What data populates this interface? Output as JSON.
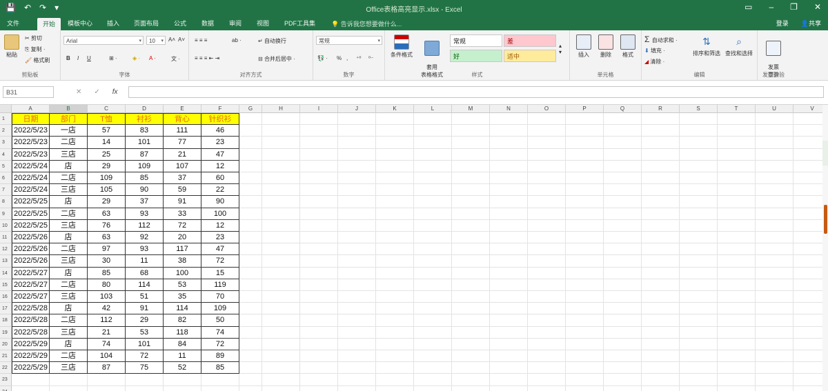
{
  "window": {
    "title": "Office表格高亮显示.xlsx - Excel",
    "user": "共享",
    "login": "登录",
    "qat": {
      "save": "💾",
      "undo": "↶",
      "redo": "↷",
      "more": "▾"
    },
    "controls": {
      "ribbon_opts": "▭",
      "minimize": "–",
      "restore": "❐",
      "close": "✕"
    }
  },
  "tabs": [
    "文件",
    "开始",
    "模板中心",
    "插入",
    "页面布局",
    "公式",
    "数据",
    "审阅",
    "视图",
    "PDF工具集"
  ],
  "active_tab": "开始",
  "tell_me": "告诉我您想要做什么...",
  "ribbon": {
    "clipboard": {
      "label": "剪贴板",
      "paste": "粘贴",
      "cut": "剪切",
      "copy": "复制 ·",
      "format_painter": "格式刷"
    },
    "font": {
      "label": "字体",
      "font_name": "Arial",
      "font_size": "10",
      "grow": "A˄",
      "shrink": "A˅",
      "bold": "B",
      "italic": "I",
      "underline": "U",
      "border": "⊞ ·",
      "fill": "◈ ·",
      "color": "A ·",
      "wen": "文 ·"
    },
    "alignment": {
      "label": "对齐方式",
      "wrap": "自动换行",
      "merge": "合并后居中 ·",
      "orient": "ab ·"
    },
    "number": {
      "label": "数字",
      "format": "常规",
      "currency": "💱 ·",
      "percent": "%",
      "comma": ",",
      "dec_inc": "⁺⁰",
      "dec_dec": "⁰⁻"
    },
    "styles": {
      "label": "样式",
      "conditional": "条件格式",
      "table": "套用\n表格格式",
      "normal": "常规",
      "bad": "差",
      "good": "好",
      "neutral": "适中"
    },
    "cells": {
      "label": "单元格",
      "insert": "插入",
      "delete": "删除",
      "format": "格式"
    },
    "editing": {
      "label": "编辑",
      "autosum": "自动求和 ·",
      "fill": "填充 ·",
      "clear": "清除 ·",
      "sort": "排序和筛选",
      "find": "查找和选择"
    },
    "invoice": {
      "label": "发票查验",
      "check": "发票\n查验"
    }
  },
  "namebox": "B31",
  "formula": "",
  "fx_symbols": {
    "cancel": "✕",
    "confirm": "✓",
    "fx": "fx"
  },
  "columns": [
    "A",
    "B",
    "C",
    "D",
    "E",
    "F",
    "G",
    "H",
    "I",
    "J",
    "K",
    "L",
    "M",
    "N",
    "O",
    "P",
    "Q",
    "R",
    "S",
    "T",
    "U",
    "V"
  ],
  "selected_column": "B",
  "rows": [
    "1",
    "2",
    "3",
    "4",
    "5",
    "6",
    "7",
    "8",
    "9",
    "10",
    "11",
    "12",
    "13",
    "14",
    "15",
    "16",
    "17",
    "18",
    "19",
    "20",
    "21",
    "22",
    "23",
    "24"
  ],
  "table": {
    "headers": [
      "日期",
      "部门",
      "T恤",
      "衬衫",
      "背心",
      "针织衫"
    ],
    "rows": [
      [
        "2022/5/23",
        "一店",
        "57",
        "83",
        "111",
        "46"
      ],
      [
        "2022/5/23",
        "二店",
        "14",
        "101",
        "77",
        "23"
      ],
      [
        "2022/5/23",
        "三店",
        "25",
        "87",
        "21",
        "47"
      ],
      [
        "2022/5/24",
        "店",
        "29",
        "109",
        "107",
        "12"
      ],
      [
        "2022/5/24",
        "二店",
        "109",
        "85",
        "37",
        "60"
      ],
      [
        "2022/5/24",
        "三店",
        "105",
        "90",
        "59",
        "22"
      ],
      [
        "2022/5/25",
        "店",
        "29",
        "37",
        "91",
        "90"
      ],
      [
        "2022/5/25",
        "二店",
        "63",
        "93",
        "33",
        "100"
      ],
      [
        "2022/5/25",
        "三店",
        "76",
        "112",
        "72",
        "12"
      ],
      [
        "2022/5/26",
        "店",
        "63",
        "92",
        "20",
        "23"
      ],
      [
        "2022/5/26",
        "二店",
        "97",
        "93",
        "117",
        "47"
      ],
      [
        "2022/5/26",
        "三店",
        "30",
        "11",
        "38",
        "72"
      ],
      [
        "2022/5/27",
        "店",
        "85",
        "68",
        "100",
        "15"
      ],
      [
        "2022/5/27",
        "二店",
        "80",
        "114",
        "53",
        "119"
      ],
      [
        "2022/5/27",
        "三店",
        "103",
        "51",
        "35",
        "70"
      ],
      [
        "2022/5/28",
        "店",
        "42",
        "91",
        "114",
        "109"
      ],
      [
        "2022/5/28",
        "二店",
        "112",
        "29",
        "82",
        "50"
      ],
      [
        "2022/5/28",
        "三店",
        "21",
        "53",
        "118",
        "74"
      ],
      [
        "2022/5/29",
        "店",
        "74",
        "101",
        "84",
        "72"
      ],
      [
        "2022/5/29",
        "二店",
        "104",
        "72",
        "11",
        "89"
      ],
      [
        "2022/5/29",
        "三店",
        "87",
        "75",
        "52",
        "85"
      ]
    ]
  },
  "colors": {
    "excel_green": "#217346",
    "header_fill": "#ffff00",
    "header_text": "#e36c09",
    "bad_fill": "#ffc7ce",
    "good_fill": "#c6efce",
    "neutral_fill": "#ffeb9c"
  }
}
